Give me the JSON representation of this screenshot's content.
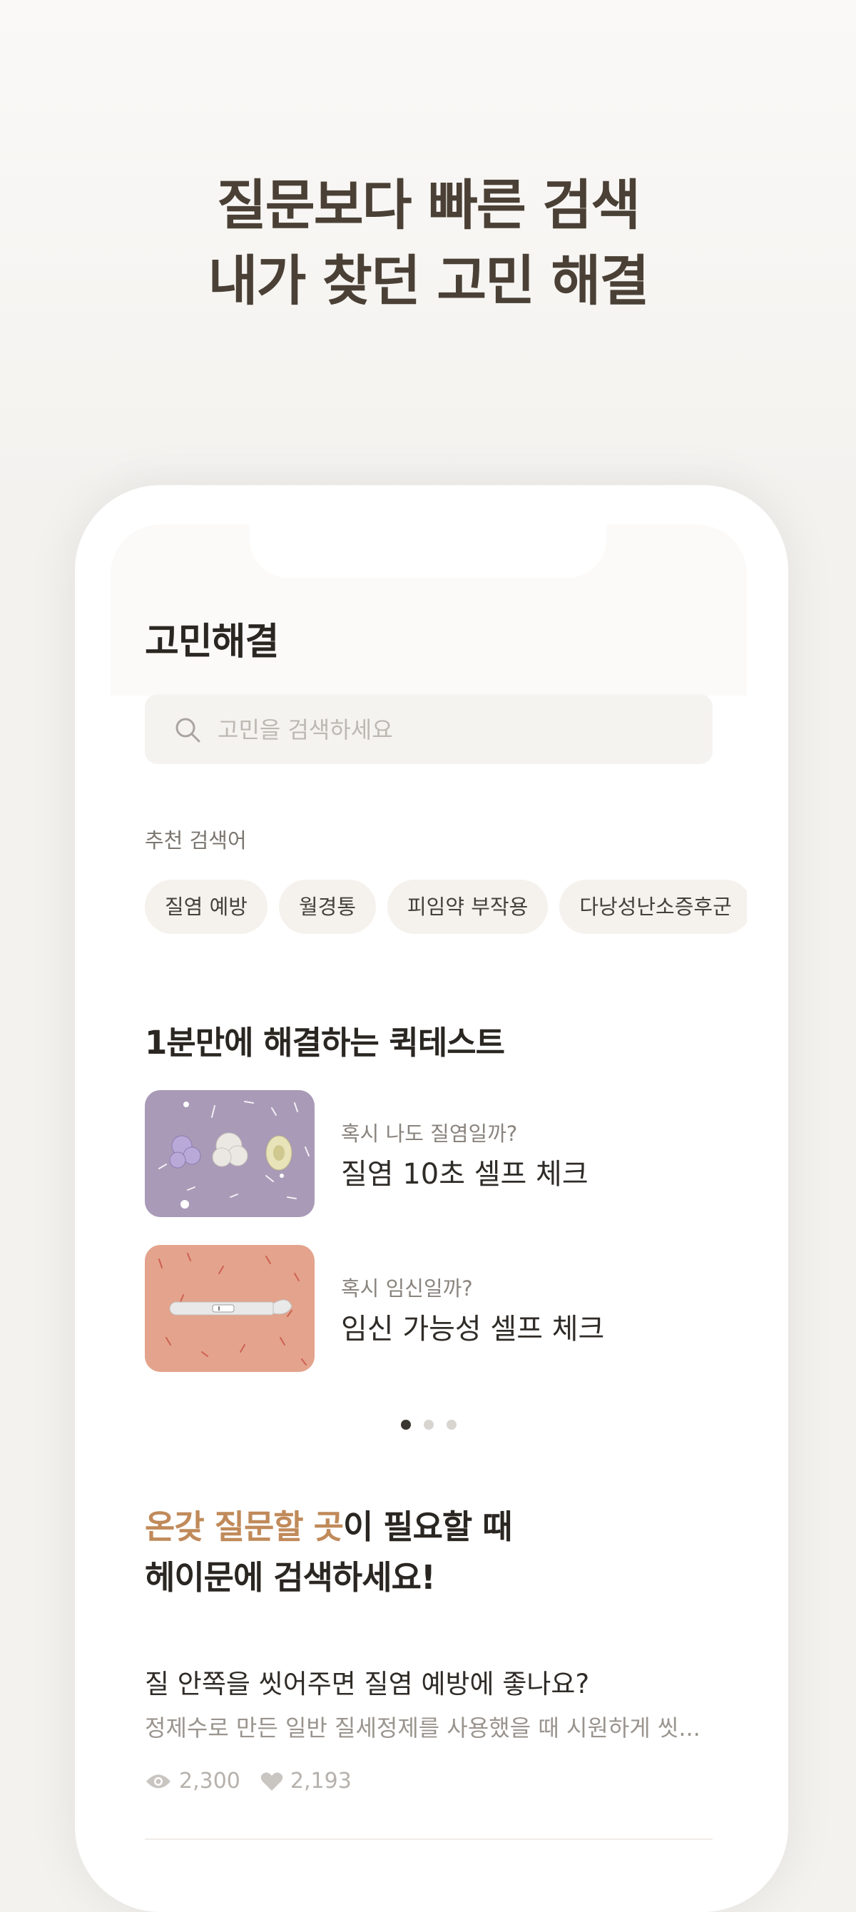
{
  "headline": {
    "line1": "질문보다 빠른 검색",
    "line2": "내가 찾던 고민 해결"
  },
  "screen": {
    "title": "고민해결",
    "search": {
      "placeholder": "고민을 검색하세요",
      "value": ""
    },
    "recommended": {
      "label": "추천 검색어",
      "chips": [
        "질염 예방",
        "월경통",
        "피임약 부작용",
        "다낭성난소증후군"
      ]
    },
    "quest_section": {
      "title": "1분만에 해결하는 퀵테스트",
      "items": [
        {
          "subtitle": "혹시 나도 질염일까?",
          "title": "질염 10초 셀프 체크",
          "thumb_color": "#a99ab7"
        },
        {
          "subtitle": "혹시 임신일까?",
          "title": "임신 가능성 셀프 체크",
          "thumb_color": "#e4a38c"
        }
      ],
      "pagination": {
        "total": 3,
        "active": 1
      }
    },
    "promo": {
      "accent": "온갖 질문할 곳",
      "line1_rest": "이 필요할 때",
      "line2": "헤이문에 검색하세요!"
    },
    "post": {
      "title": "질 안쪽을 씻어주면 질염 예방에 좋나요?",
      "excerpt": "정제수로 만든 일반 질세정제를 사용했을 때 시원하게 씻...",
      "views": "2,300",
      "likes": "2,193"
    }
  }
}
